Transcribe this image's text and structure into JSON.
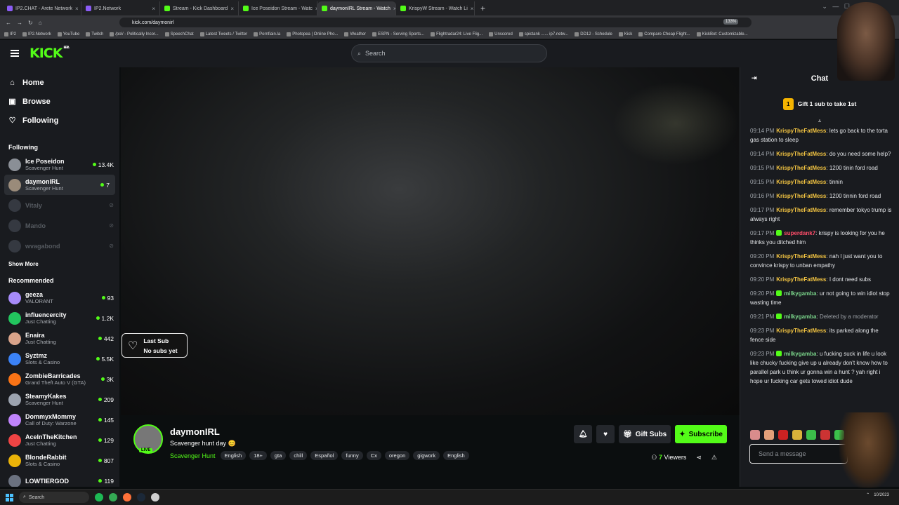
{
  "browser": {
    "tabs": [
      {
        "label": "IP2.CHAT - Arete Network",
        "active": false
      },
      {
        "label": "IP2.Network",
        "active": false
      },
      {
        "label": "Stream - Kick Dashboard",
        "active": false
      },
      {
        "label": "Ice Poseidon Stream - Watc",
        "active": false
      },
      {
        "label": "daymonIRL Stream - Watch",
        "active": true
      },
      {
        "label": "KrispyW Stream - Watch Li",
        "active": false
      }
    ],
    "url": "kick.com/daymonirl",
    "zoom": "133%",
    "bookmarks": [
      "IP2",
      "IP2.Network",
      "YouTube",
      "Twitch",
      "/pol/ - Politically Incor...",
      "SpeechChat",
      "Latest Tweets / Twitter",
      "Pornfiain.la",
      "Photopea | Online Pho...",
      "Weather",
      "ESPN - Serving Sports...",
      "Flightradar24: Live Flig...",
      "Unscored",
      "spictank ...... ip7.netw...",
      "DD12 - Schedule",
      "Kick",
      "Compare Cheap Flight...",
      "KickBot: Customizable..."
    ]
  },
  "header": {
    "logo": "KICK",
    "logo_badge": "BETA",
    "search_placeholder": "Search"
  },
  "sidebar": {
    "nav": [
      {
        "label": "Home",
        "icon": "home-icon"
      },
      {
        "label": "Browse",
        "icon": "browse-icon"
      },
      {
        "label": "Following",
        "icon": "heart-icon"
      }
    ],
    "following_title": "Following",
    "following": [
      {
        "name": "Ice Poseidon",
        "category": "Scavenger Hunt",
        "viewers": "13.4K",
        "live": true,
        "active": false
      },
      {
        "name": "daymonIRL",
        "category": "Scavenger Hunt",
        "viewers": "7",
        "live": true,
        "active": true
      },
      {
        "name": "Vitaly",
        "category": "",
        "viewers": "",
        "live": false,
        "active": false
      },
      {
        "name": "Mando",
        "category": "",
        "viewers": "",
        "live": false,
        "active": false
      },
      {
        "name": "wvagabond",
        "category": "",
        "viewers": "",
        "live": false,
        "active": false
      }
    ],
    "show_more": "Show More",
    "recommended_title": "Recommended",
    "recommended": [
      {
        "name": "geeza",
        "category": "VALORANT",
        "viewers": "93"
      },
      {
        "name": "influencercity",
        "category": "Just Chatting",
        "viewers": "1.2K"
      },
      {
        "name": "Enaira",
        "category": "Just Chatting",
        "viewers": "442"
      },
      {
        "name": "Syztmz",
        "category": "Slots & Casino",
        "viewers": "5.5K"
      },
      {
        "name": "ZombieBarricades",
        "category": "Grand Theft Auto V (GTA)",
        "viewers": "3K"
      },
      {
        "name": "SteamyKakes",
        "category": "Scavenger Hunt",
        "viewers": "209"
      },
      {
        "name": "DommyxMommy",
        "category": "Call of Duty: Warzone",
        "viewers": "145"
      },
      {
        "name": "AceInTheKitchen",
        "category": "Just Chatting",
        "viewers": "129"
      },
      {
        "name": "BlondeRabbit",
        "category": "Slots & Casino",
        "viewers": "807"
      },
      {
        "name": "LOWTIERGOD",
        "category": "",
        "viewers": "119"
      }
    ]
  },
  "player": {
    "last_sub_title": "Last Sub",
    "last_sub_value": "No subs yet"
  },
  "stream": {
    "streamer": "daymonIRL",
    "live_label": "LIVE",
    "title": "Scavenger hunt day 😊",
    "category": "Scavenger Hunt",
    "tags": [
      "English",
      "18+",
      "gta",
      "chill",
      "Español",
      "funny",
      "Cx",
      "oregon",
      "gigwork",
      "English"
    ],
    "gift_subs": "Gift Subs",
    "subscribe": "Subscribe",
    "viewers_count": "7",
    "viewers_label": "Viewers"
  },
  "chat": {
    "title": "Chat",
    "gift_badge": "1",
    "gift_text": "Gift 1 sub to take 1st",
    "messages": [
      {
        "time": "09:14 PM",
        "user": "KrispyTheFatMess",
        "color": "y",
        "badge": false,
        "text": "lets go back to the torta gas station to sleep"
      },
      {
        "time": "09:14 PM",
        "user": "KrispyTheFatMess",
        "color": "y",
        "badge": false,
        "text": "do you need some help?"
      },
      {
        "time": "09:15 PM",
        "user": "KrispyTheFatMess",
        "color": "y",
        "badge": false,
        "text": "1200 tinin ford road"
      },
      {
        "time": "09:15 PM",
        "user": "KrispyTheFatMess",
        "color": "y",
        "badge": false,
        "text": "tinnin"
      },
      {
        "time": "09:16 PM",
        "user": "KrispyTheFatMess",
        "color": "y",
        "badge": false,
        "text": "1200 tinnin ford road"
      },
      {
        "time": "09:17 PM",
        "user": "KrispyTheFatMess",
        "color": "y",
        "badge": false,
        "text": "remember tokyo trump is always right"
      },
      {
        "time": "09:17 PM",
        "user": "superdank7",
        "color": "r",
        "badge": true,
        "text": "krispy is looking for you he thinks you ditched him"
      },
      {
        "time": "09:20 PM",
        "user": "KrispyTheFatMess",
        "color": "y",
        "badge": false,
        "text": "nah I just want you to convince krispy to unban empathy"
      },
      {
        "time": "09:20 PM",
        "user": "KrispyTheFatMess",
        "color": "y",
        "badge": false,
        "text": "I dont need subs"
      },
      {
        "time": "09:20 PM",
        "user": "milkygamba",
        "color": "g",
        "badge": true,
        "text": "ur not going to win idiot stop wasting time"
      },
      {
        "time": "09:21 PM",
        "user": "milkygamba",
        "color": "g",
        "badge": true,
        "text": "Deleted by a moderator",
        "deleted": true
      },
      {
        "time": "09:23 PM",
        "user": "KrispyTheFatMess",
        "color": "y",
        "badge": false,
        "text": "its parked along the fence side"
      },
      {
        "time": "09:23 PM",
        "user": "milkygamba",
        "color": "g",
        "badge": true,
        "text": "u fucking suck in life u look like chucky fucking give up u already don't know how to parallel park u think ur gonna win a hunt ? yah right i hope ur fucking car gets towed idiot dude"
      }
    ],
    "emote_colors": [
      "#d98c8c",
      "#e3a07a",
      "#cc2222",
      "#d9b23a",
      "#3bbf4a",
      "#cc3333",
      "#3bbf4a",
      "#33aa33"
    ],
    "input_placeholder": "Send a message"
  },
  "taskbar": {
    "search": "Search",
    "date": "10/2023"
  }
}
